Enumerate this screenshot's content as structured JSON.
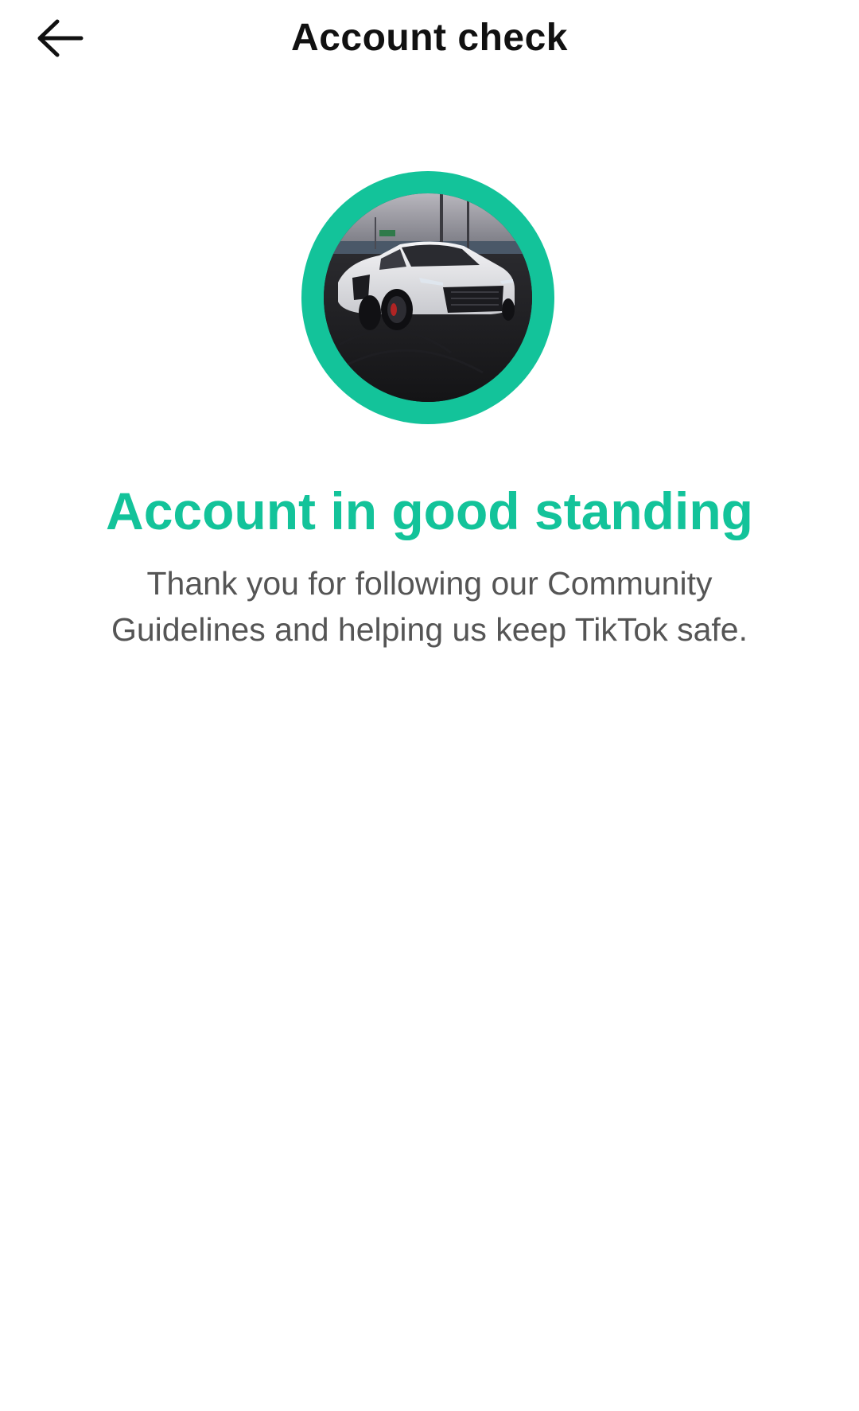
{
  "header": {
    "title": "Account check",
    "back_icon": "arrow-left-icon"
  },
  "avatar": {
    "ring_color": "#13c39a",
    "content": "white sports car on dark pavement"
  },
  "status": {
    "title": "Account in good standing",
    "title_color": "#13c39a",
    "message_lines": [
      "Thank you for following our Community",
      "Guidelines and helping us keep TikTok safe."
    ],
    "message_color": "#555555"
  }
}
